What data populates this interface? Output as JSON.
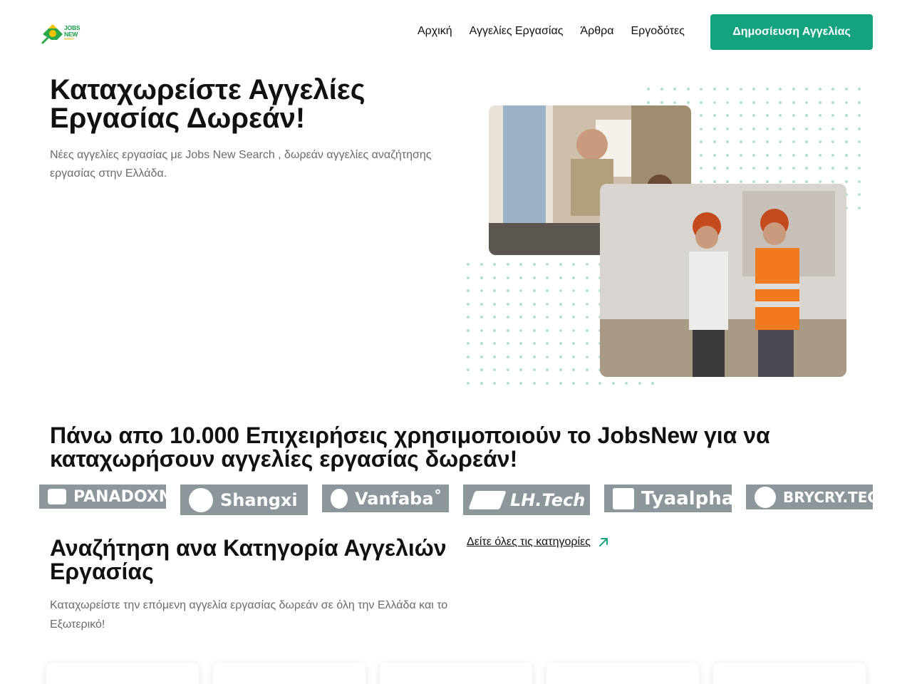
{
  "header": {
    "logo_text": [
      "JOBS",
      "NEW",
      "search"
    ],
    "nav": [
      "Αρχική",
      "Αγγελίες Εργασίας",
      "Άρθρα",
      "Εργοδότες"
    ],
    "cta_label": "Δημοσίευση Αγγελίας"
  },
  "hero": {
    "title": "Καταχωρείστε Αγγελίες Εργασίας Δωρεάν!",
    "subtitle": "Νέες αγγελίες εργασίας με Jobs New Search , δωρεάν αγγελίες αναζήτησης εργασίας στην Ελλάδα."
  },
  "partners": {
    "title": "Πάνω απο 10.000 Επιχειρήσεις χρησιμοποιούν το JobsNew για να καταχωρήσουν αγγελίες εργασίας δωρεάν!",
    "logos": [
      "PANADOXN",
      "Shangxi",
      "Vanfaba˚",
      "LH.Tech",
      "Tyaalpha",
      "BRYCRY.TEC"
    ]
  },
  "categories": {
    "title": "Αναζήτηση ανα Κατηγορία Αγγελιών Εργασίας",
    "subtitle": "Καταχωρείστε την επόμενη αγγελία εργασίας δωρεάν σε όλη την Ελλάδα και το Εξωτερικό!",
    "see_all_label": "Δείτε όλες τις κατηγορίες"
  },
  "colors": {
    "accent": "#14a37f",
    "text": "#111111",
    "muted": "#6b6b6b",
    "logo_tile": "#8d969b",
    "dot": "#b4e0d2"
  }
}
